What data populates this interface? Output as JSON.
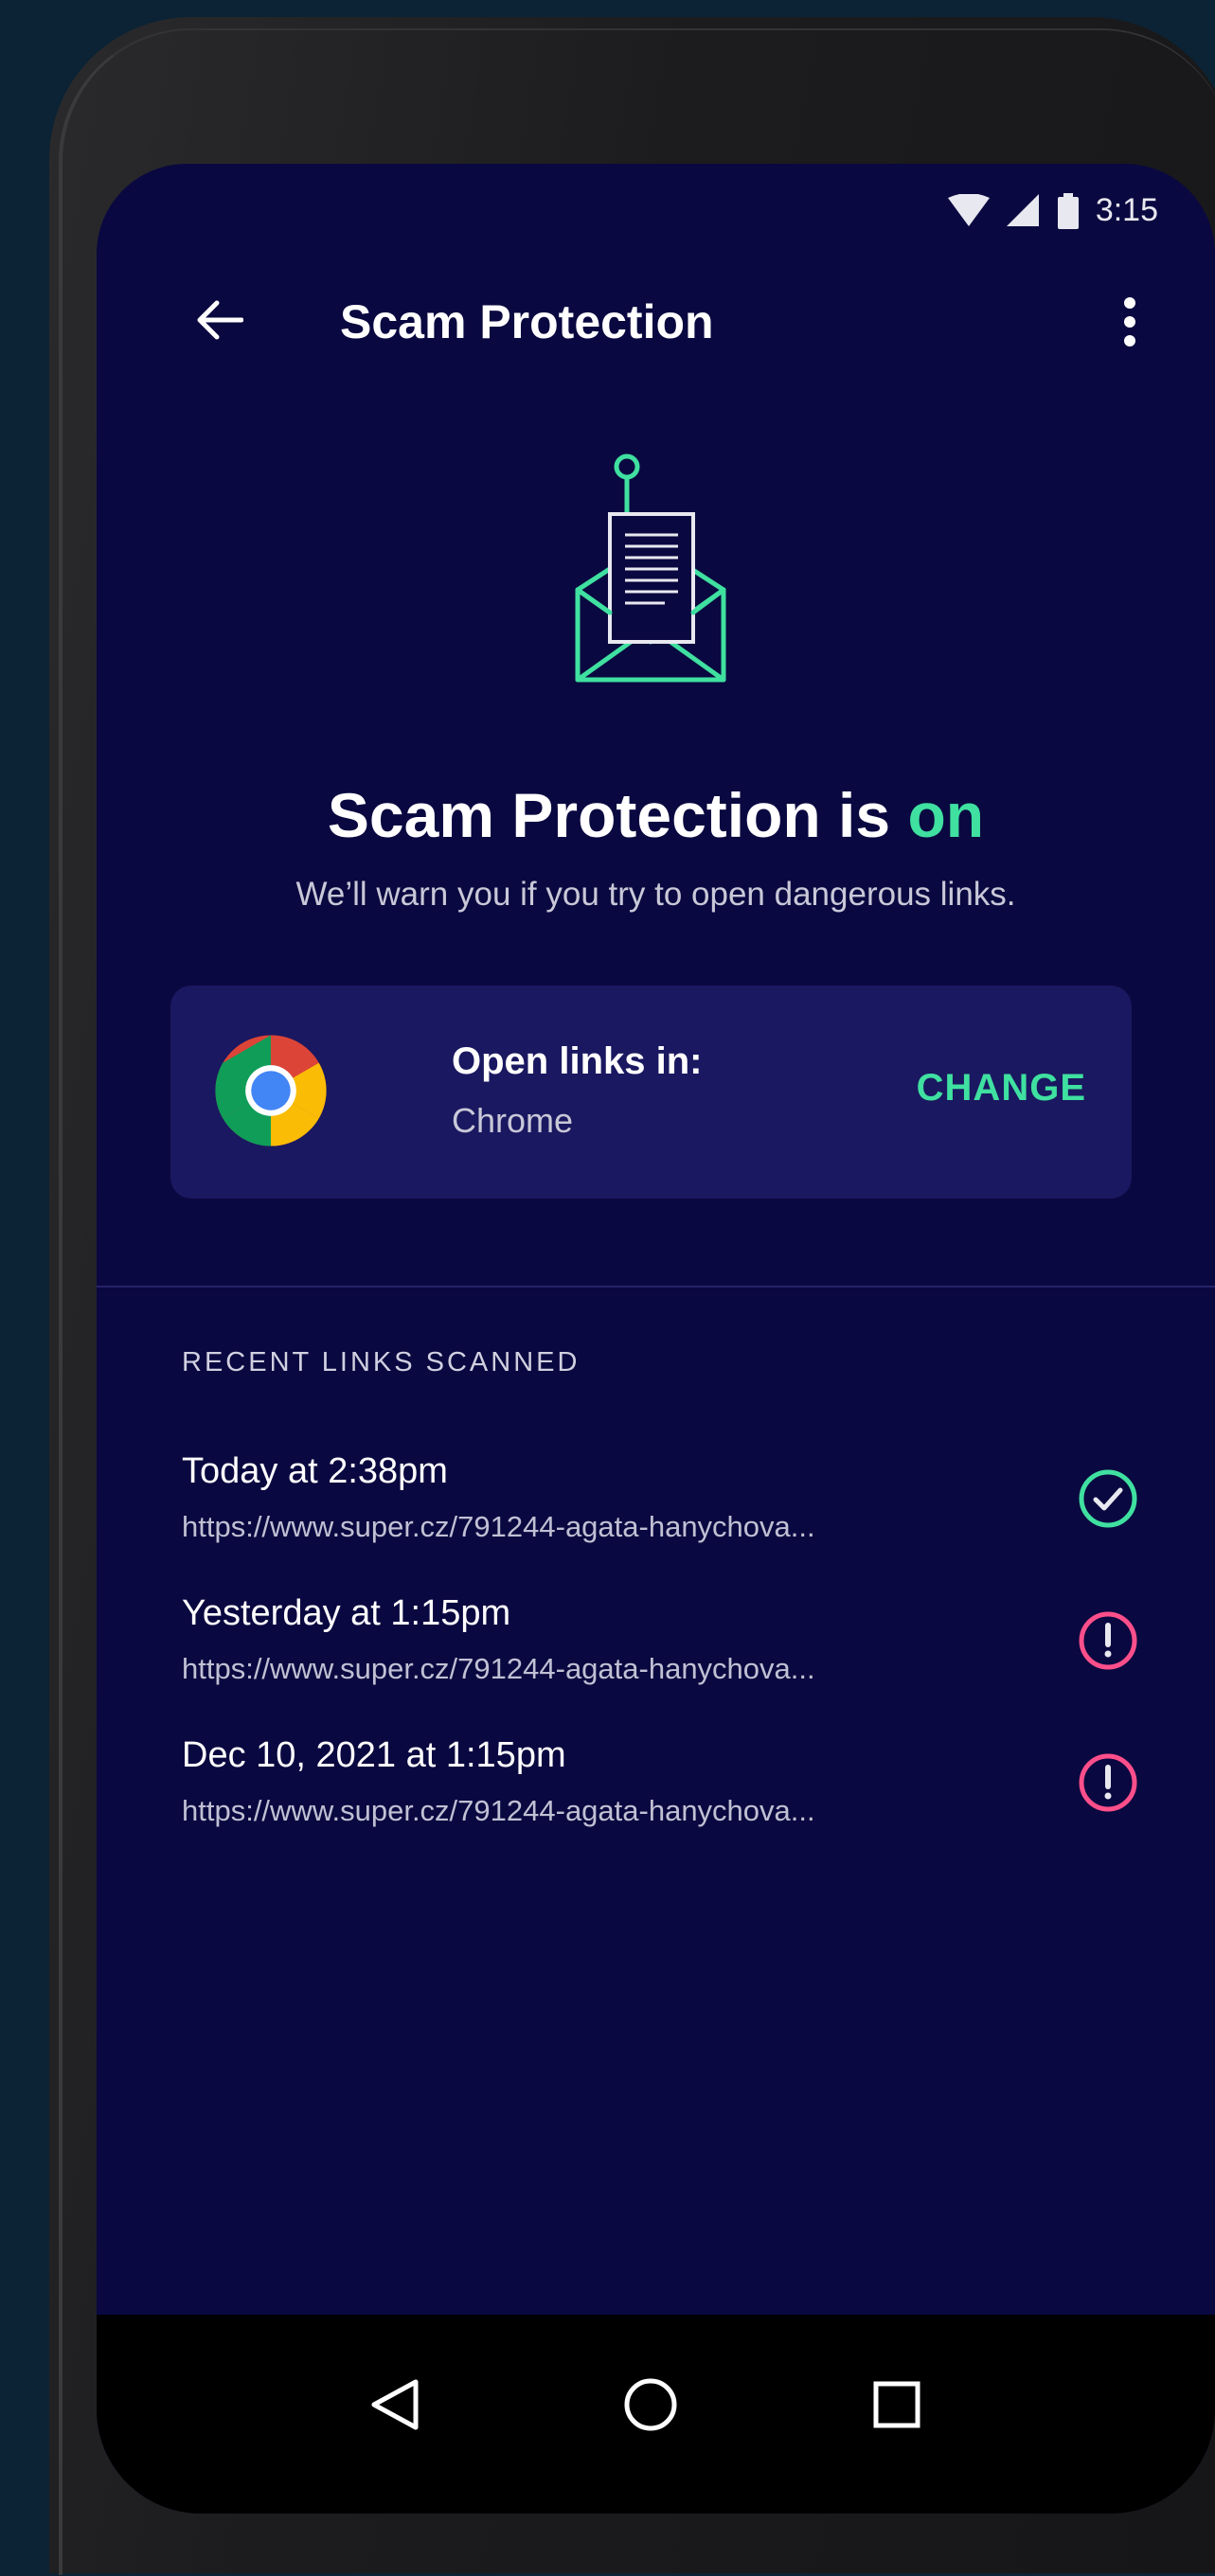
{
  "status_bar": {
    "time": "3:15"
  },
  "app_bar": {
    "title": "Scam Protection"
  },
  "hero": {
    "heading_prefix": "Scam Protection is ",
    "heading_state": "on",
    "subtitle": "We’ll warn you if you try to open dangerous links."
  },
  "browser_card": {
    "label": "Open links in:",
    "browser": "Chrome",
    "action": "CHANGE"
  },
  "recent": {
    "title": "RECENT LINKS SCANNED",
    "items": [
      {
        "time": "Today at 2:38pm",
        "url": "https://www.super.cz/791244-agata-hanychova...",
        "status": "safe"
      },
      {
        "time": "Yesterday at 1:15pm",
        "url": "https://www.super.cz/791244-agata-hanychova...",
        "status": "warning"
      },
      {
        "time": "Dec 10, 2021 at 1:15pm",
        "url": "https://www.super.cz/791244-agata-hanychova...",
        "status": "warning"
      }
    ]
  },
  "colors": {
    "background": "#0a0840",
    "accent": "#3fe0a0",
    "warning": "#ff4f8b",
    "card": "#1a1860"
  },
  "icons": {
    "back": "arrow-left-icon",
    "menu": "more-vert-icon",
    "hero": "phishing-envelope-icon",
    "safe": "check-circle-icon",
    "warning": "exclamation-circle-icon"
  }
}
